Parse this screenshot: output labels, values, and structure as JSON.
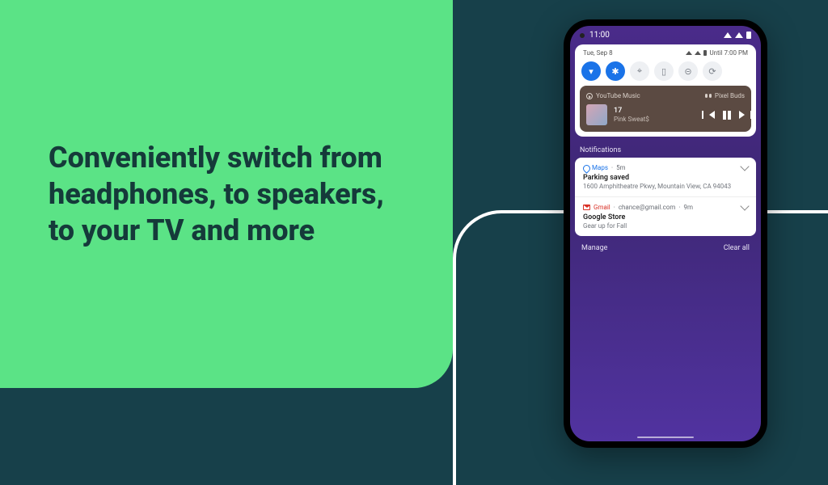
{
  "marketing": {
    "headline": "Conveniently switch from headphones, to speakers, to your TV and more"
  },
  "statusbar": {
    "time": "11:00"
  },
  "shade": {
    "date": "Tue, Sep 8",
    "until_label": "Until 7:00 PM"
  },
  "media": {
    "app": "YouTube Music",
    "output": "Pixel Buds",
    "track_title": "17",
    "track_artist": "Pink Sweat$"
  },
  "notifications": {
    "section_label": "Notifications",
    "items": [
      {
        "app": "Maps",
        "time": "5m",
        "title": "Parking saved",
        "body": "1600 Amphitheatre Pkwy, Mountain View, CA 94043"
      },
      {
        "app": "Gmail",
        "account": "chance@gmail.com",
        "time": "9m",
        "title": "Google Store",
        "body": "Gear up for Fall"
      }
    ]
  },
  "footer": {
    "manage": "Manage",
    "clear": "Clear all"
  }
}
